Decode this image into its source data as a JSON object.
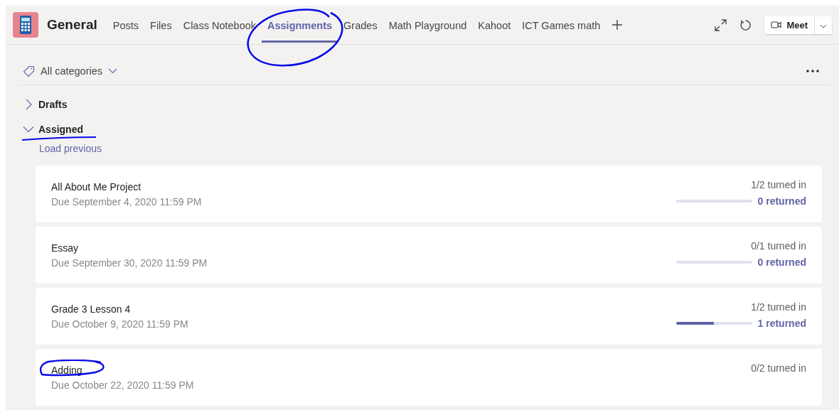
{
  "header": {
    "title": "General",
    "tabs": [
      {
        "label": "Posts",
        "selected": false
      },
      {
        "label": "Files",
        "selected": false
      },
      {
        "label": "Class Notebook",
        "selected": false
      },
      {
        "label": "Assignments",
        "selected": true
      },
      {
        "label": "Grades",
        "selected": false
      },
      {
        "label": "Math Playground",
        "selected": false
      },
      {
        "label": "Kahoot",
        "selected": false
      },
      {
        "label": "ICT Games math",
        "selected": false
      }
    ],
    "meet_button": "Meet"
  },
  "filter": {
    "label": "All categories"
  },
  "sections": [
    {
      "label": "Drafts",
      "expanded": false
    },
    {
      "label": "Assigned",
      "expanded": true
    }
  ],
  "load_previous": "Load previous",
  "assignments": [
    {
      "title": "All About Me Project",
      "due": "Due September 4, 2020 11:59 PM",
      "turned_in": "1/2 turned in",
      "level": 0,
      "returned": "0 returned"
    },
    {
      "title": "Essay",
      "due": "Due September 30, 2020 11:59 PM",
      "turned_in": "0/1 turned in",
      "level": 0,
      "returned": "0 returned"
    },
    {
      "title": "Grade 3 Lesson 4",
      "due": "Due October 9, 2020 11:59 PM",
      "turned_in": "1/2 turned in",
      "level": 0.5,
      "returned": "1 returned"
    },
    {
      "title": "Adding",
      "due": "Due October 22, 2020 11:59 PM",
      "turned_in": "0/2 turned in"
    }
  ]
}
